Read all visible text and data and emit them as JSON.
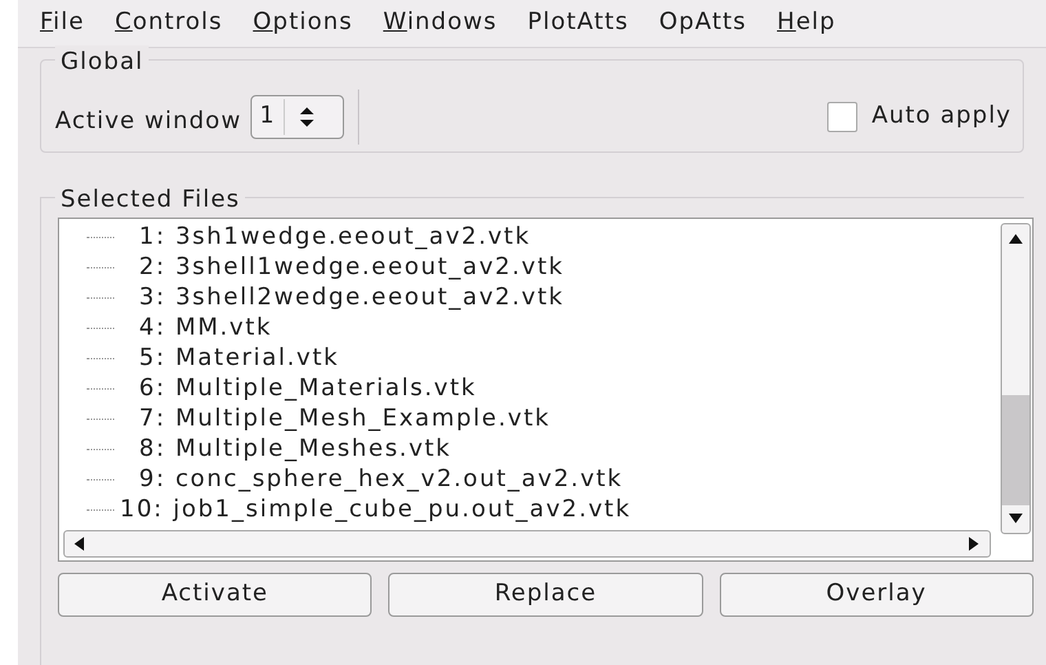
{
  "menu": [
    {
      "label": "File",
      "mnemonic": true
    },
    {
      "label": "Controls",
      "mnemonic": true
    },
    {
      "label": "Options",
      "mnemonic": true
    },
    {
      "label": "Windows",
      "mnemonic": true
    },
    {
      "label": "PlotAtts",
      "mnemonic": false
    },
    {
      "label": "OpAtts",
      "mnemonic": false
    },
    {
      "label": "Help",
      "mnemonic": true
    }
  ],
  "global": {
    "title": "Global",
    "active_window_label": "Active window",
    "active_window_value": "1",
    "auto_apply": {
      "label": "Auto apply",
      "checked": false
    }
  },
  "selected_files": {
    "title": "Selected Files",
    "files": [
      {
        "index": "1:",
        "name": "3sh1wedge.eeout_av2.vtk"
      },
      {
        "index": "2:",
        "name": "3shell1wedge.eeout_av2.vtk"
      },
      {
        "index": "3:",
        "name": "3shell2wedge.eeout_av2.vtk"
      },
      {
        "index": "4:",
        "name": "MM.vtk"
      },
      {
        "index": "5:",
        "name": "Material.vtk"
      },
      {
        "index": "6:",
        "name": "Multiple_Materials.vtk"
      },
      {
        "index": "7:",
        "name": "Multiple_Mesh_Example.vtk"
      },
      {
        "index": "8:",
        "name": "Multiple_Meshes.vtk"
      },
      {
        "index": "9:",
        "name": "conc_sphere_hex_v2.out_av2.vtk"
      },
      {
        "index": "10:",
        "name": "job1_simple_cube_pu.out_av2.vtk"
      }
    ]
  },
  "buttons": [
    "Activate",
    "Replace",
    "Overlay"
  ]
}
